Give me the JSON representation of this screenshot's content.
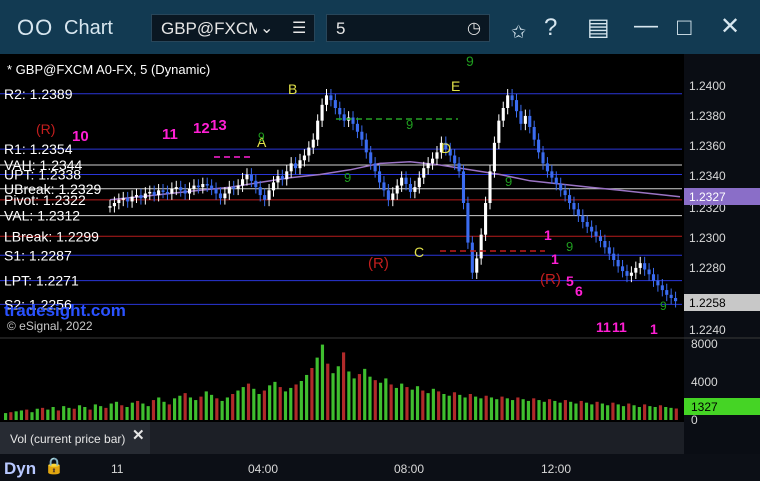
{
  "window": {
    "title": "Chart",
    "symbol_input": "GBP@FXCM",
    "interval_input": "5",
    "icons": [
      "chart-window-icon",
      "symbol-dropdown-icon",
      "symbol-menu-icon",
      "interval-clock-icon",
      "pen-icon",
      "help-icon",
      "layout-icon",
      "minimize-icon",
      "maximize-icon",
      "close-icon"
    ]
  },
  "chart": {
    "header": "* GBP@FXCM A0-FX, 5 (Dynamic)",
    "watermark": "tradesight.com",
    "copyright": "© eSignal, 2022",
    "price_axis": [
      "1.2400",
      "1.2380",
      "1.2360",
      "1.2340",
      "1.2320",
      "1.2300",
      "1.2280",
      "1.2240"
    ],
    "last_price_tag": "1.2327",
    "last_price_tag_color": "#8a6ec8",
    "current_price_tag": "1.2258",
    "current_price_tag_color": "#c8c8c8",
    "levels": [
      {
        "label": "R2: 1.2389",
        "color": "#2a36d8"
      },
      {
        "label": "R1: 1.2354",
        "color": "#2a36d8"
      },
      {
        "label": "VAH: 1.2344",
        "color": "#cfcfcf"
      },
      {
        "label": "UPT: 1.2338",
        "color": "#2a36d8"
      },
      {
        "label": "UBreak: 1.2329",
        "color": "#cfcfcf"
      },
      {
        "label": "Pivot: 1.2322",
        "color": "#b71c1c"
      },
      {
        "label": "VAL: 1.2312",
        "color": "#cfcfcf"
      },
      {
        "label": "LBreak: 1.2299",
        "color": "#b71c1c"
      },
      {
        "label": "S1: 1.2287",
        "color": "#2a36d8"
      },
      {
        "label": "LPT: 1.2271",
        "color": "#2a36d8"
      },
      {
        "label": "S2: 1.2256",
        "color": "#2a36d8"
      }
    ],
    "annotations": {
      "waves": [
        "A",
        "B",
        "C",
        "D",
        "E"
      ],
      "reversal_marks": [
        "(R)",
        "(R)",
        "(R)"
      ],
      "count_numbers": [
        "10",
        "11",
        "12",
        "13",
        "9",
        "1",
        "1",
        "5",
        "6",
        "9",
        "11",
        "11",
        "1"
      ],
      "setup_digits": [
        "9",
        "9",
        "9",
        "9",
        "9",
        "9"
      ]
    },
    "volume": {
      "label": "Vol (current price bar)",
      "axis": [
        "8000",
        "4000",
        "0"
      ],
      "current_tag": "1327",
      "current_tag_color": "#45d425"
    },
    "time_axis": {
      "label": "Dyn",
      "ticks": [
        "11",
        "04:00",
        "08:00",
        "12:00"
      ]
    },
    "colors": {
      "up_bar": "#ffffff",
      "down_bar": "#3b6cf0",
      "average_line": "#9b74c4",
      "volume_up": "#3fbf2f",
      "volume_down": "#b02a2a",
      "wave_label": "#e1e14a",
      "count_label": "#ff1fd4",
      "reversal_label": "#c41e1e",
      "setup_label": "#1f9d1f"
    }
  },
  "chart_data": {
    "type": "candlestick",
    "title": "* GBP@FXCM A0-FX, 5 (Dynamic)",
    "x_ticks": [
      "11",
      "04:00",
      "08:00",
      "12:00"
    ],
    "y_ticks": [
      1.224,
      1.228,
      1.23,
      1.232,
      1.234,
      1.236,
      1.238,
      1.24
    ],
    "ylim": [
      1.2236,
      1.2404
    ],
    "close_series": [
      1.2318,
      1.232,
      1.2322,
      1.2323,
      1.2321,
      1.2324,
      1.2325,
      1.2323,
      1.2326,
      1.2327,
      1.2325,
      1.2328,
      1.2327,
      1.2326,
      1.2329,
      1.233,
      1.2328,
      1.2326,
      1.2329,
      1.2331,
      1.233,
      1.2332,
      1.2331,
      1.2329,
      1.2326,
      1.2323,
      1.2326,
      1.233,
      1.2329,
      1.2331,
      1.2335,
      1.2338,
      1.2334,
      1.233,
      1.2325,
      1.2322,
      1.2328,
      1.2333,
      1.2337,
      1.2335,
      1.234,
      1.2345,
      1.2342,
      1.2347,
      1.235,
      1.2355,
      1.236,
      1.2372,
      1.2382,
      1.2388,
      1.2385,
      1.238,
      1.2376,
      1.2372,
      1.2374,
      1.237,
      1.2365,
      1.236,
      1.2352,
      1.2345,
      1.234,
      1.2333,
      1.2328,
      1.2322,
      1.2326,
      1.2331,
      1.2336,
      1.2332,
      1.2327,
      1.233,
      1.2336,
      1.2342,
      1.2345,
      1.2348,
      1.2352,
      1.2358,
      1.2354,
      1.235,
      1.2345,
      1.234,
      1.232,
      1.2295,
      1.2276,
      1.2285,
      1.23,
      1.232,
      1.234,
      1.2358,
      1.2372,
      1.238,
      1.2388,
      1.2385,
      1.2378,
      1.237,
      1.2375,
      1.2368,
      1.236,
      1.2352,
      1.2345,
      1.234,
      1.2336,
      1.2332,
      1.2328,
      1.2325,
      1.232,
      1.2316,
      1.2312,
      1.2308,
      1.2305,
      1.2302,
      1.2299,
      1.2296,
      1.2292,
      1.2288,
      1.2284,
      1.228,
      1.2277,
      1.2274,
      1.2276,
      1.2279,
      1.2282,
      1.2278,
      1.2275,
      1.2271,
      1.2268,
      1.2265,
      1.2262,
      1.226,
      1.2258
    ],
    "average_series": [
      1.2322,
      1.2324,
      1.2326,
      1.2328,
      1.233,
      1.2333,
      1.2336,
      1.2338,
      1.2341,
      1.2345,
      1.2346,
      1.2344,
      1.2341,
      1.2338,
      1.2334,
      1.2332,
      1.233,
      1.2328,
      1.2326,
      1.2324
    ],
    "volume_series": [
      800,
      900,
      1000,
      1100,
      1200,
      900,
      1300,
      1400,
      1200,
      1500,
      1100,
      1600,
      1400,
      1300,
      1700,
      1500,
      1200,
      1800,
      1600,
      1400,
      1900,
      2100,
      1700,
      1500,
      2000,
      2200,
      1900,
      1600,
      2300,
      2600,
      2100,
      1800,
      2500,
      2800,
      3100,
      2600,
      2300,
      2700,
      3300,
      2900,
      2500,
      2200,
      2600,
      3000,
      3400,
      3800,
      4200,
      3600,
      3000,
      3400,
      4000,
      4400,
      3800,
      3300,
      3700,
      4100,
      4500,
      5200,
      6000,
      7200,
      8700,
      6500,
      5400,
      6200,
      7800,
      5600,
      4800,
      5300,
      5900,
      5000,
      4600,
      4300,
      4800,
      4100,
      3700,
      4200,
      3800,
      3500,
      3900,
      3400,
      3100,
      3600,
      3300,
      3000,
      2800,
      3200,
      2900,
      2600,
      3000,
      2700,
      2500,
      2800,
      2600,
      2400,
      2700,
      2500,
      2300,
      2600,
      2400,
      2200,
      2500,
      2300,
      2100,
      2400,
      2200,
      2000,
      2300,
      2100,
      1900,
      2200,
      2000,
      1800,
      2100,
      1900,
      1700,
      2000,
      1800,
      1600,
      1900,
      1700,
      1500,
      1800,
      1600,
      1500,
      1700,
      1500,
      1400,
      1327
    ],
    "volume_ylim": [
      0,
      9000
    ]
  }
}
